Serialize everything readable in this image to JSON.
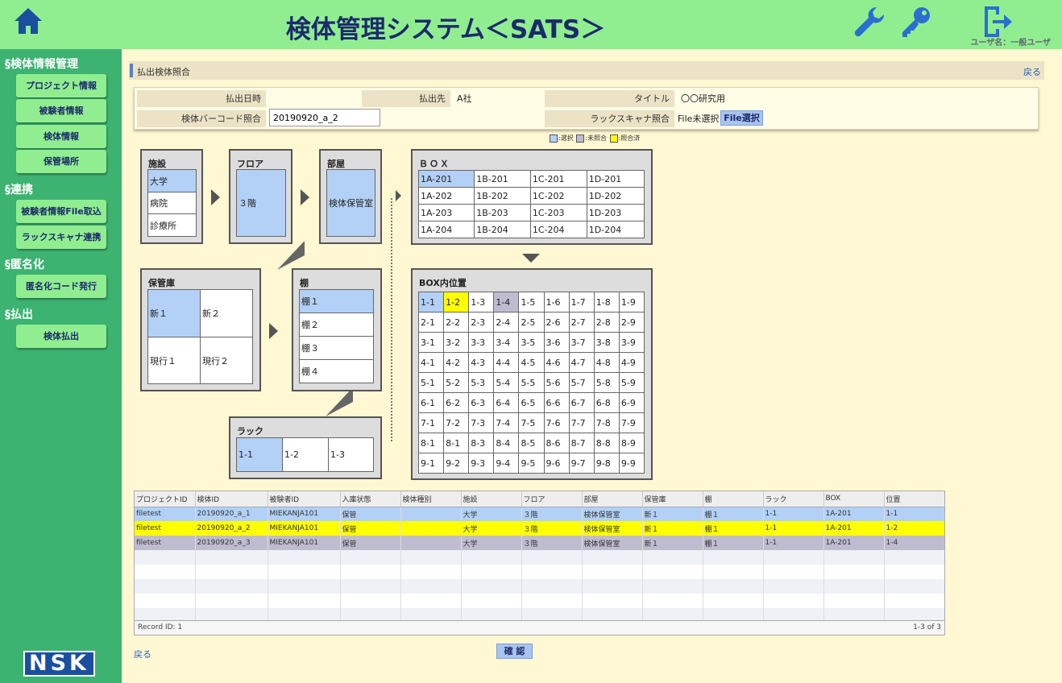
{
  "header": {
    "title": "検体管理システム＜SATS＞",
    "user_label": "ユーザ名：一般ユーザ",
    "icons": [
      "home-icon",
      "wrench-icon",
      "key-icon",
      "logout-icon"
    ]
  },
  "sidebar": {
    "sections": [
      {
        "title": "§検体情報管理",
        "items": [
          "プロジェクト情報",
          "被験者情報",
          "検体情報",
          "保管場所"
        ]
      },
      {
        "title": "§連携",
        "items": [
          "被験者情報File取込",
          "ラックスキャナ連携"
        ]
      },
      {
        "title": "§匿名化",
        "items": [
          "匿名化コード発行"
        ]
      },
      {
        "title": "§払出",
        "items": [
          "検体払出"
        ]
      }
    ],
    "logo": "NSK"
  },
  "breadcrumb": {
    "title": "払出検体照合",
    "back": "戻る"
  },
  "form": {
    "date_label": "払出日時",
    "date_value": "",
    "dest_label": "払出先",
    "dest_value": "A社",
    "title_label": "タイトル",
    "title_value": "〇〇研究用",
    "barcode_label": "検体バーコード照合",
    "barcode_value": "20190920_a_2",
    "scanner_label": "ラックスキャナ照合",
    "scanner_status": "File未選択",
    "file_button": "File選択"
  },
  "legend": {
    "selected": ":選択",
    "unmatched": ":未照合",
    "matched": ":照合済",
    "colors": {
      "selected": "#b3d1f7",
      "unmatched": "#c0bcd0",
      "matched": "#ffff00"
    }
  },
  "facility": {
    "title": "施設",
    "items": [
      "大学",
      "病院",
      "診療所"
    ]
  },
  "floor": {
    "title": "フロア",
    "items": [
      "３階"
    ]
  },
  "room": {
    "title": "部屋",
    "items": [
      "検体保管室"
    ]
  },
  "storage": {
    "title": "保管庫",
    "items": [
      "新１",
      "新２",
      "現行１",
      "現行２"
    ]
  },
  "shelf": {
    "title": "棚",
    "items": [
      "棚１",
      "棚２",
      "棚３",
      "棚４"
    ]
  },
  "rack": {
    "title": "ラック",
    "items": [
      "1-1",
      "1-2",
      "1-3"
    ]
  },
  "box": {
    "title": "ＢＯＸ",
    "rows": [
      [
        "1A-201",
        "1B-201",
        "1C-201",
        "1D-201"
      ],
      [
        "1A-202",
        "1B-202",
        "1C-202",
        "1D-202"
      ],
      [
        "1A-203",
        "1B-203",
        "1C-203",
        "1D-203"
      ],
      [
        "1A-204",
        "1B-204",
        "1C-204",
        "1D-204"
      ]
    ]
  },
  "position": {
    "title": "BOX内位置",
    "rows": [
      [
        "1-1",
        "1-2",
        "1-3",
        "1-4",
        "1-5",
        "1-6",
        "1-7",
        "1-8",
        "1-9"
      ],
      [
        "2-1",
        "2-2",
        "2-3",
        "2-4",
        "2-5",
        "2-6",
        "2-7",
        "2-8",
        "2-9"
      ],
      [
        "3-1",
        "3-2",
        "3-3",
        "3-4",
        "3-5",
        "3-6",
        "3-7",
        "3-8",
        "3-9"
      ],
      [
        "4-1",
        "4-2",
        "4-3",
        "4-4",
        "4-5",
        "4-6",
        "4-7",
        "4-8",
        "4-9"
      ],
      [
        "5-1",
        "5-2",
        "5-3",
        "5-4",
        "5-5",
        "5-6",
        "5-7",
        "5-8",
        "5-9"
      ],
      [
        "6-1",
        "6-2",
        "6-3",
        "6-4",
        "6-5",
        "6-6",
        "6-7",
        "6-8",
        "6-9"
      ],
      [
        "7-1",
        "7-2",
        "7-3",
        "7-4",
        "7-5",
        "7-6",
        "7-7",
        "7-8",
        "7-9"
      ],
      [
        "8-1",
        "8-1",
        "8-3",
        "8-4",
        "8-5",
        "8-6",
        "8-7",
        "8-8",
        "8-9"
      ],
      [
        "9-1",
        "9-2",
        "9-3",
        "9-4",
        "9-5",
        "9-6",
        "9-7",
        "9-8",
        "9-9"
      ]
    ]
  },
  "table": {
    "columns": [
      "プロジェクトID",
      "検体ID",
      "被験者ID",
      "入庫状態",
      "検体種別",
      "施設",
      "フロア",
      "部屋",
      "保管庫",
      "棚",
      "ラック",
      "BOX",
      "位置"
    ],
    "rows": [
      {
        "status": "selected",
        "cells": [
          "filetest",
          "20190920_a_1",
          "MIEKANJA101",
          "保管",
          "",
          "大学",
          "３階",
          "検体保管室",
          "新１",
          "棚１",
          "1-1",
          "1A-201",
          "1-1"
        ]
      },
      {
        "status": "matched",
        "cells": [
          "filetest",
          "20190920_a_2",
          "MIEKANJA101",
          "保管",
          "",
          "大学",
          "３階",
          "検体保管室",
          "新１",
          "棚１",
          "1-1",
          "1A-201",
          "1-2"
        ]
      },
      {
        "status": "unmatched",
        "cells": [
          "filetest",
          "20190920_a_3",
          "MIEKANJA101",
          "保管",
          "",
          "大学",
          "３階",
          "検体保管室",
          "新１",
          "棚１",
          "1-1",
          "1A-201",
          "1-4"
        ]
      }
    ],
    "record_id": "Record ID: 1",
    "range": "1-3 of 3"
  },
  "footer": {
    "back": "戻る",
    "confirm": "確 認"
  }
}
